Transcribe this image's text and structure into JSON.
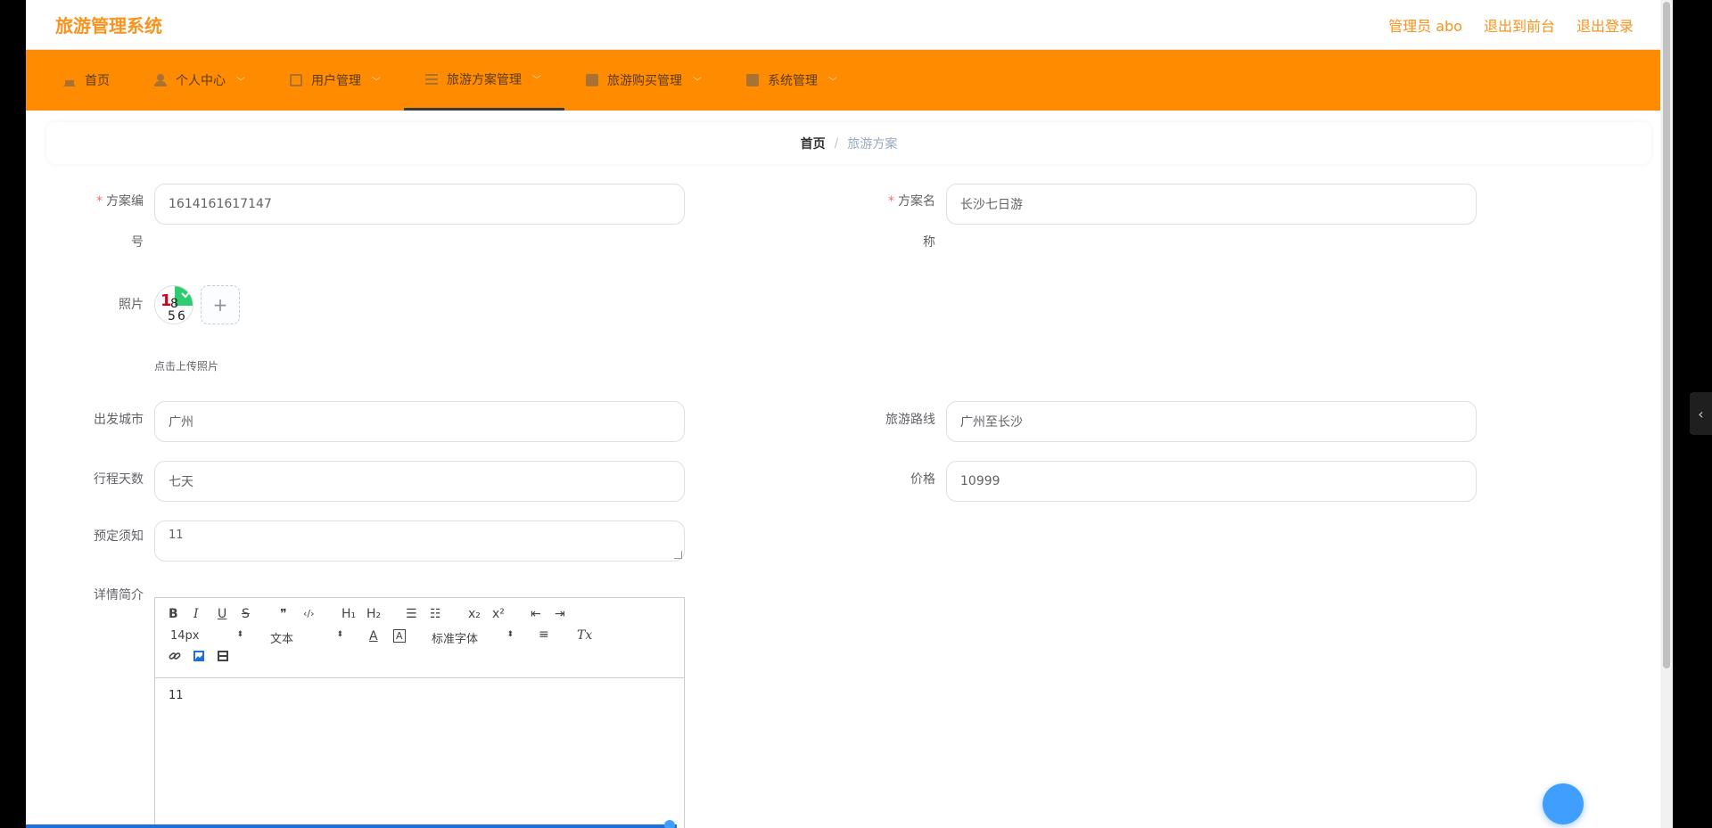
{
  "header": {
    "brand": "旅游管理系统",
    "admin": "管理员 abo",
    "to_front": "退出到前台",
    "logout": "退出登录"
  },
  "nav": {
    "items": [
      {
        "label": "首页",
        "icon": "home-icon"
      },
      {
        "label": "个人中心",
        "icon": "user-icon"
      },
      {
        "label": "用户管理",
        "icon": "card-icon"
      },
      {
        "label": "旅游方案管理",
        "icon": "list-icon"
      },
      {
        "label": "旅游购买管理",
        "icon": "doc-icon"
      },
      {
        "label": "系统管理",
        "icon": "doc-icon"
      }
    ],
    "active_index": 3
  },
  "breadcrumb": {
    "home": "首页",
    "separator": "/",
    "current": "旅游方案"
  },
  "form": {
    "plan_no": {
      "label_a": "方案编",
      "label_b": "号",
      "value": "1614161617147"
    },
    "plan_name": {
      "label_a": "方案名",
      "label_b": "称",
      "value": "长沙七日游"
    },
    "photo": {
      "label": "照片",
      "hint": "点击上传照片",
      "add": "+"
    },
    "city": {
      "label": "出发城市",
      "value": "广州"
    },
    "route": {
      "label": "旅游路线",
      "value": "广州至长沙"
    },
    "days": {
      "label": "行程天数",
      "value": "七天"
    },
    "price": {
      "label": "价格",
      "value": "10999"
    },
    "notice": {
      "label": "预定须知",
      "value": "11"
    },
    "detail": {
      "label": "详情简介",
      "value": "11"
    }
  },
  "editor": {
    "bold": "B",
    "italic": "I",
    "underline": "U",
    "strike": "S",
    "quote": "❞",
    "code": "‹/›",
    "h1": "H₁",
    "h2": "H₂",
    "ol": "☰",
    "ul": "☷",
    "sub": "x₂",
    "sup": "x²",
    "outdent": "⇤",
    "indent": "⇥",
    "size": "14px",
    "format": "文本",
    "font": "标准字体",
    "align": "≡",
    "clear": "Tx",
    "color": "A",
    "bg": "A",
    "link": "🔗",
    "image": "▣",
    "video": "▤",
    "caret": "⬍"
  },
  "side_tab": "‹",
  "colors": {
    "brand": "#f7931e",
    "nav": "#ff8c00",
    "required": "#f56c6c"
  }
}
